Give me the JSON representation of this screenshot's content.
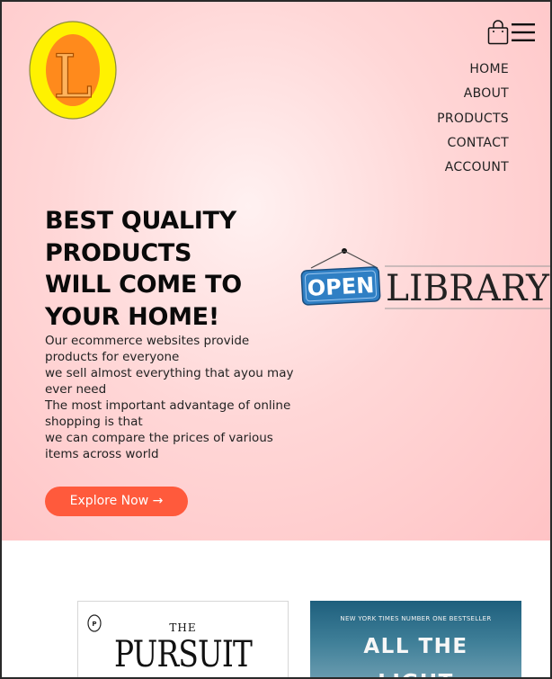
{
  "header": {
    "logo_letter": "L",
    "nav": [
      "HOME",
      "ABOUT",
      "PRODUCTS",
      "CONTACT",
      "ACCOUNT"
    ]
  },
  "hero": {
    "headline_lines": [
      "BEST QUALITY",
      "PRODUCTS",
      "WILL COME TO",
      "YOUR HOME!"
    ],
    "description_lines": [
      "Our ecommerce websites provide products for everyone",
      "we sell almost everything that ayou may ever need",
      "The most important advantage of online shopping is that",
      "we can compare the prices of various items across world"
    ],
    "cta_label": "Explore Now →",
    "sign_open": "OPEN",
    "sign_library": "LIBRARY"
  },
  "products": [
    {
      "cover_small": "THE",
      "cover_title": "PURSUIT"
    },
    {
      "cover_tag": "NEW YORK TIMES NUMBER ONE BESTSELLER",
      "cover_title": "ALL THE",
      "cover_title_2": "LIGHT"
    }
  ],
  "colors": {
    "accent": "#ff5a3c",
    "hero_bg": "#ffc3c5",
    "logo_yellow": "#fff200",
    "logo_orange": "#ff8a1c",
    "sign_blue": "#2f7fc4"
  },
  "icons": {
    "cart": "shopping-bag-icon",
    "menu": "hamburger-menu-icon"
  }
}
